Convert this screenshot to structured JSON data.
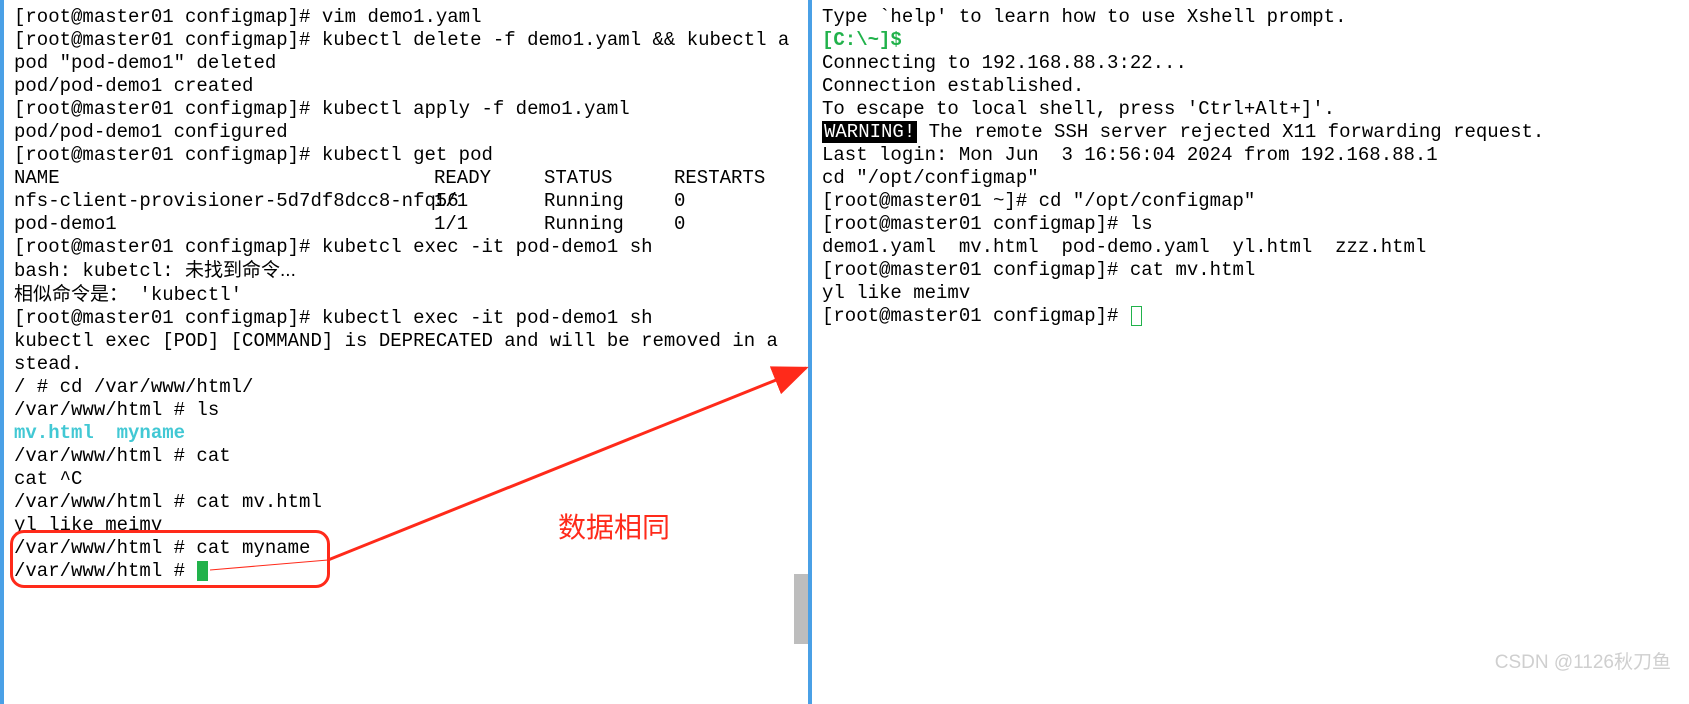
{
  "left": {
    "l0": "[root@master01 configmap]# vim demo1.yaml",
    "l1": "[root@master01 configmap]# kubectl delete -f demo1.yaml && kubectl a",
    "l2": "pod \"pod-demo1\" deleted",
    "l3": "pod/pod-demo1 created",
    "l4": "[root@master01 configmap]# kubectl apply -f demo1.yaml",
    "l5": "pod/pod-demo1 configured",
    "l6": "[root@master01 configmap]# kubectl get pod",
    "hdr": {
      "name": "NAME",
      "ready": "READY",
      "status": "STATUS",
      "rest": "RESTARTS"
    },
    "r1": {
      "name": "nfs-client-provisioner-5d7df8dcc8-nfq56",
      "ready": "1/1",
      "status": "Running",
      "rest": "0"
    },
    "r2": {
      "name": "pod-demo1",
      "ready": "1/1",
      "status": "Running",
      "rest": "0"
    },
    "l7": "[root@master01 configmap]# kubetcl exec -it pod-demo1 sh",
    "l8a": "bash: kubetcl: ",
    "l8b": "未找到命令...",
    "l9a": "相似命令是：",
    "l9b": " 'kubectl'",
    "l10": "[root@master01 configmap]# kubectl exec -it pod-demo1 sh",
    "l11": "kubectl exec [POD] [COMMAND] is DEPRECATED and will be removed in a",
    "l12": "stead.",
    "l13": "/ # cd /var/www/html/",
    "l14": "/var/www/html # ls",
    "l15a": "mv.html ",
    "l15b": " myname",
    "l16": "/var/www/html # cat",
    "l17": "",
    "l18": "cat ^C",
    "l19": "/var/www/html # cat mv.html",
    "l20": "yl like meimv",
    "l21": "/var/www/html # cat myname",
    "l22": "/var/www/html # "
  },
  "right": {
    "l0": "",
    "l1": "Type `help' to learn how to use Xshell prompt.",
    "l2": "[C:\\~]$ ",
    "l3": "",
    "l4": "Connecting to 192.168.88.3:22...",
    "l5": "Connection established.",
    "l6": "To escape to local shell, press 'Ctrl+Alt+]'.",
    "l7": "",
    "l8a": "WARNING!",
    "l8b": " The remote SSH server rejected X11 forwarding request.",
    "l9": "Last login: Mon Jun  3 16:56:04 2024 from 192.168.88.1",
    "l10": "cd \"/opt/configmap\"",
    "l11": "[root@master01 ~]# cd \"/opt/configmap\"",
    "l12": "[root@master01 configmap]# ls",
    "l13": "demo1.yaml  mv.html  pod-demo.yaml  yl.html  zzz.html",
    "l14": "[root@master01 configmap]# cat mv.html",
    "l15": "yl like meimv",
    "l16": "[root@master01 configmap]# "
  },
  "annotation": {
    "label": "数据相同"
  },
  "watermark": "CSDN @1126秋刀鱼"
}
